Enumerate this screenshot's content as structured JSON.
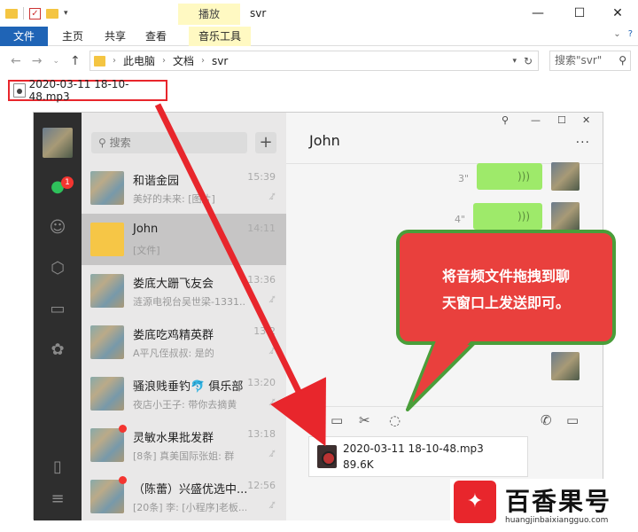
{
  "explorer": {
    "title": "svr",
    "contextual_tab": "播放",
    "ribbon_tabs": [
      "文件",
      "主页",
      "共享",
      "查看"
    ],
    "music_tab": "音乐工具",
    "path": [
      "此电脑",
      "文档",
      "svr"
    ],
    "search_placeholder": "搜索\"svr\"",
    "file_name": "2020-03-11 18-10-48.mp3",
    "controls": {
      "minimize": "—",
      "maximize": "☐",
      "close": "✕"
    }
  },
  "wechat": {
    "unread_badge": "1",
    "search_placeholder": "搜索",
    "plus": "+",
    "window_controls": {
      "pin": "⚲",
      "minimize": "—",
      "maximize": "☐",
      "close": "✕"
    },
    "conversations": [
      {
        "name": "和谐金园",
        "msg": "美好的未来: [图片]",
        "time": "15:39",
        "selected": false,
        "dot": false
      },
      {
        "name": "John",
        "msg": "[文件]",
        "time": "14:11",
        "selected": true,
        "dot": false
      },
      {
        "name": "娄底大跚飞友会",
        "msg": "涟源电视台吴世梁-1331...",
        "time": "13:36",
        "selected": false,
        "dot": false
      },
      {
        "name": "娄底吃鸡精英群",
        "msg": "A平凡侄叔叔: 是的",
        "time": "13:2",
        "selected": false,
        "dot": false
      },
      {
        "name": "骚浪贱垂钓🐬 俱乐部",
        "msg": "夜店小王子: 带你去摘黄",
        "time": "13:20",
        "selected": false,
        "dot": false
      },
      {
        "name": "灵敏水果批发群",
        "msg": "[8条] 真美国际张姐: 群",
        "time": "13:18",
        "selected": false,
        "dot": true
      },
      {
        "name": "（陈蕾）兴盛优选中...",
        "msg": "[20条] 李: [小程序]老板...",
        "time": "12:56",
        "selected": false,
        "dot": true
      }
    ],
    "chat_title": "John",
    "more": "···",
    "voice_messages": [
      {
        "duration": "3\""
      },
      {
        "duration": "4\""
      }
    ],
    "file_card": {
      "name": "2020-03-11 18-10-48.mp3",
      "size": "89.6K"
    }
  },
  "callout": {
    "line1": "将音频文件拖拽到聊",
    "line2": "天窗口上发送即可。"
  },
  "watermark": {
    "logo_text": "百香果号",
    "url": "huangjinbaixiangguo.com"
  },
  "colors": {
    "accent_red": "#e8262c",
    "wechat_green": "#2ec15b",
    "callout_border": "#4a9e3a"
  }
}
